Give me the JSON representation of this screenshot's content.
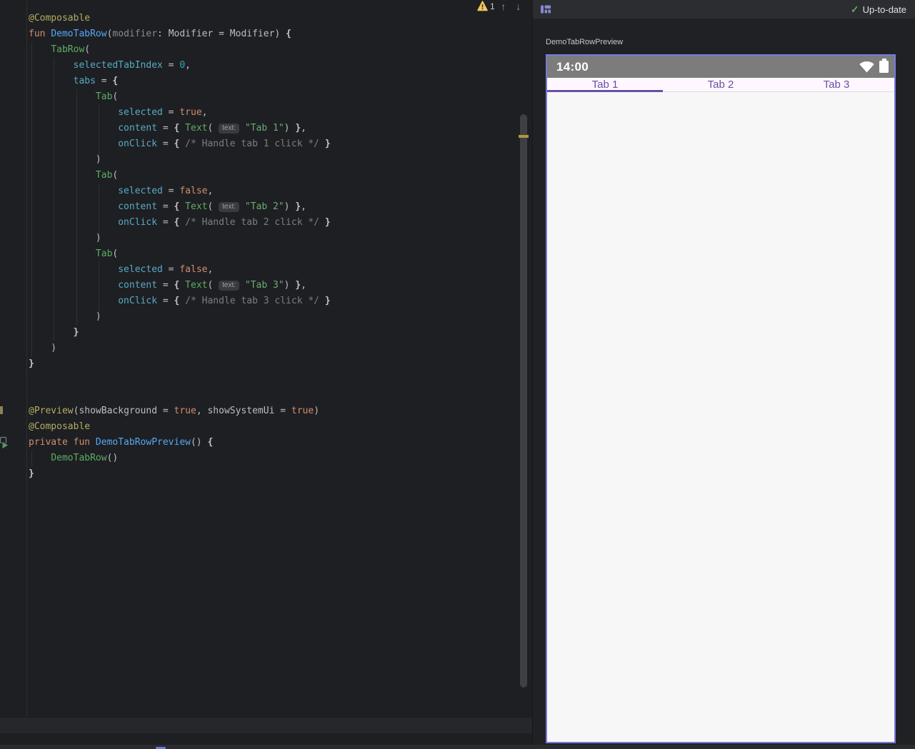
{
  "colors": {
    "editor_bg": "#1E1F22",
    "panel_toolbar_bg": "#2B2D30",
    "preview_canvas_bg": "#202124",
    "frame_selected_border": "#767BDF",
    "phone_statusbar_gray": "#7C7C7C",
    "tab_purple": "#6750A4",
    "tabrow_surface": "#FEF7FF",
    "warning_yellow": "#F2C55C",
    "warning_stripe": "#B3953F",
    "check_green": "#62A75F",
    "grid_icon_purple": "#8688D2"
  },
  "icons": {
    "check": "✓",
    "arrow_up": "↑",
    "arrow_down": "↓"
  },
  "editor": {
    "inspection": {
      "warnings": "1"
    },
    "lines": [
      [
        [
          "ann",
          "@Composable"
        ]
      ],
      [
        [
          "kw",
          "fun "
        ],
        [
          "fn",
          "DemoTabRow"
        ],
        [
          "txt",
          "("
        ],
        [
          "param",
          "modifier"
        ],
        [
          "txt",
          ": Modifier = Modifier) "
        ],
        [
          "brace",
          "{"
        ]
      ],
      [
        [
          "txt",
          "    "
        ],
        [
          "call",
          "TabRow"
        ],
        [
          "txt",
          "("
        ]
      ],
      [
        [
          "txt",
          "        "
        ],
        [
          "arg",
          "selectedTabIndex"
        ],
        [
          "txt",
          " = "
        ],
        [
          "num",
          "0"
        ],
        [
          "txt",
          ","
        ]
      ],
      [
        [
          "txt",
          "        "
        ],
        [
          "arg",
          "tabs"
        ],
        [
          "txt",
          " = "
        ],
        [
          "brace",
          "{"
        ]
      ],
      [
        [
          "txt",
          "            "
        ],
        [
          "call",
          "Tab"
        ],
        [
          "txt",
          "("
        ]
      ],
      [
        [
          "txt",
          "                "
        ],
        [
          "arg",
          "selected"
        ],
        [
          "txt",
          " = "
        ],
        [
          "kw",
          "true"
        ],
        [
          "txt",
          ","
        ]
      ],
      [
        [
          "txt",
          "                "
        ],
        [
          "arg",
          "content"
        ],
        [
          "txt",
          " = "
        ],
        [
          "brace",
          "{"
        ],
        [
          "txt",
          " "
        ],
        [
          "call",
          "Text"
        ],
        [
          "txt",
          "( "
        ],
        [
          "hint",
          "text:"
        ],
        [
          "txt",
          " "
        ],
        [
          "str",
          "\"Tab 1\""
        ],
        [
          "txt",
          ") "
        ],
        [
          "brace",
          "}"
        ],
        [
          "txt",
          ","
        ]
      ],
      [
        [
          "txt",
          "                "
        ],
        [
          "arg",
          "onClick"
        ],
        [
          "txt",
          " = "
        ],
        [
          "brace",
          "{"
        ],
        [
          "cmt",
          " /* Handle tab 1 click */ "
        ],
        [
          "brace",
          "}"
        ]
      ],
      [
        [
          "txt",
          "            )"
        ]
      ],
      [
        [
          "txt",
          "            "
        ],
        [
          "call",
          "Tab"
        ],
        [
          "txt",
          "("
        ]
      ],
      [
        [
          "txt",
          "                "
        ],
        [
          "arg",
          "selected"
        ],
        [
          "txt",
          " = "
        ],
        [
          "kw",
          "false"
        ],
        [
          "txt",
          ","
        ]
      ],
      [
        [
          "txt",
          "                "
        ],
        [
          "arg",
          "content"
        ],
        [
          "txt",
          " = "
        ],
        [
          "brace",
          "{"
        ],
        [
          "txt",
          " "
        ],
        [
          "call",
          "Text"
        ],
        [
          "txt",
          "( "
        ],
        [
          "hint",
          "text:"
        ],
        [
          "txt",
          " "
        ],
        [
          "str",
          "\"Tab 2\""
        ],
        [
          "txt",
          ") "
        ],
        [
          "brace",
          "}"
        ],
        [
          "txt",
          ","
        ]
      ],
      [
        [
          "txt",
          "                "
        ],
        [
          "arg",
          "onClick"
        ],
        [
          "txt",
          " = "
        ],
        [
          "brace",
          "{"
        ],
        [
          "cmt",
          " /* Handle tab 2 click */ "
        ],
        [
          "brace",
          "}"
        ]
      ],
      [
        [
          "txt",
          "            )"
        ]
      ],
      [
        [
          "txt",
          "            "
        ],
        [
          "call",
          "Tab"
        ],
        [
          "txt",
          "("
        ]
      ],
      [
        [
          "txt",
          "                "
        ],
        [
          "arg",
          "selected"
        ],
        [
          "txt",
          " = "
        ],
        [
          "kw",
          "false"
        ],
        [
          "txt",
          ","
        ]
      ],
      [
        [
          "txt",
          "                "
        ],
        [
          "arg",
          "content"
        ],
        [
          "txt",
          " = "
        ],
        [
          "brace",
          "{"
        ],
        [
          "txt",
          " "
        ],
        [
          "call",
          "Text"
        ],
        [
          "txt",
          "( "
        ],
        [
          "hint",
          "text:"
        ],
        [
          "txt",
          " "
        ],
        [
          "str",
          "\"Tab 3\""
        ],
        [
          "txt",
          ") "
        ],
        [
          "brace",
          "}"
        ],
        [
          "txt",
          ","
        ]
      ],
      [
        [
          "txt",
          "                "
        ],
        [
          "arg",
          "onClick"
        ],
        [
          "txt",
          " = "
        ],
        [
          "brace",
          "{"
        ],
        [
          "cmt",
          " /* Handle tab 3 click */ "
        ],
        [
          "brace",
          "}"
        ]
      ],
      [
        [
          "txt",
          "            )"
        ]
      ],
      [
        [
          "txt",
          "        "
        ],
        [
          "brace",
          "}"
        ]
      ],
      [
        [
          "txt",
          "    )"
        ]
      ],
      [
        [
          "brace",
          "}"
        ]
      ],
      [],
      [],
      [
        [
          "ann",
          "@Preview"
        ],
        [
          "txt",
          "(showBackground = "
        ],
        [
          "kw",
          "true"
        ],
        [
          "txt",
          ", showSystemUi = "
        ],
        [
          "kw",
          "true"
        ],
        [
          "txt",
          ")"
        ]
      ],
      [
        [
          "ann",
          "@Composable"
        ]
      ],
      [
        [
          "kw",
          "private fun "
        ],
        [
          "fn",
          "DemoTabRowPreview"
        ],
        [
          "txt",
          "() "
        ],
        [
          "brace",
          "{"
        ]
      ],
      [
        [
          "txt",
          "    "
        ],
        [
          "call",
          "DemoTabRow"
        ],
        [
          "txt",
          "()"
        ]
      ],
      [
        [
          "brace",
          "}"
        ]
      ]
    ]
  },
  "preview_panel": {
    "status": "Up-to-date",
    "preview_label": "DemoTabRowPreview",
    "phone": {
      "clock": "14:00",
      "tabs": [
        {
          "label": "Tab 1",
          "selected": true
        },
        {
          "label": "Tab 2",
          "selected": false
        },
        {
          "label": "Tab 3",
          "selected": false
        }
      ]
    }
  }
}
